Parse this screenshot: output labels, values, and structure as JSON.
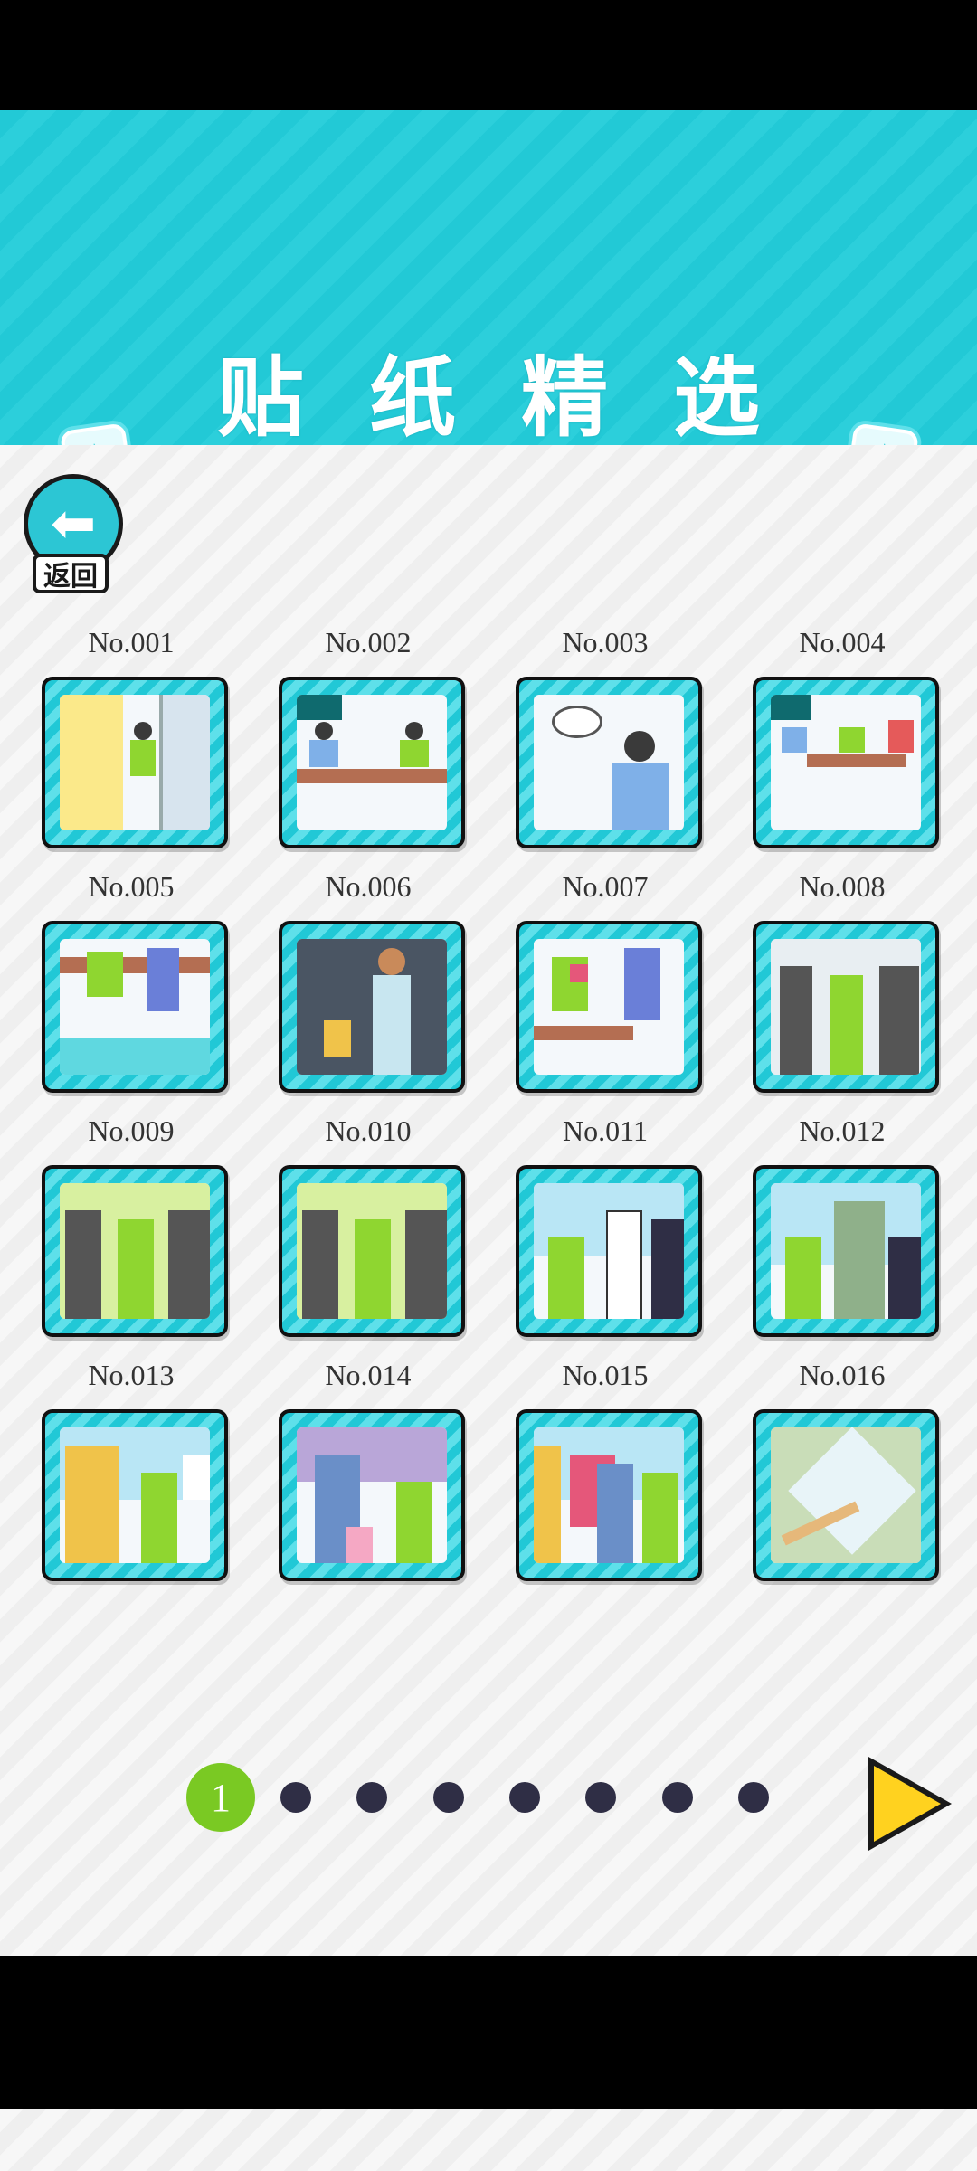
{
  "header": {
    "title": "贴纸精选"
  },
  "back": {
    "label": "返回"
  },
  "stickers": [
    {
      "no": "No.001"
    },
    {
      "no": "No.002"
    },
    {
      "no": "No.003"
    },
    {
      "no": "No.004"
    },
    {
      "no": "No.005"
    },
    {
      "no": "No.006"
    },
    {
      "no": "No.007"
    },
    {
      "no": "No.008"
    },
    {
      "no": "No.009"
    },
    {
      "no": "No.010"
    },
    {
      "no": "No.011"
    },
    {
      "no": "No.012"
    },
    {
      "no": "No.013"
    },
    {
      "no": "No.014"
    },
    {
      "no": "No.015"
    },
    {
      "no": "No.016"
    }
  ],
  "pager": {
    "current": "1",
    "total_pages": 8
  },
  "colors": {
    "accent": "#22c9d6",
    "active_dot": "#7ac923",
    "next_arrow": "#ffd21f"
  }
}
